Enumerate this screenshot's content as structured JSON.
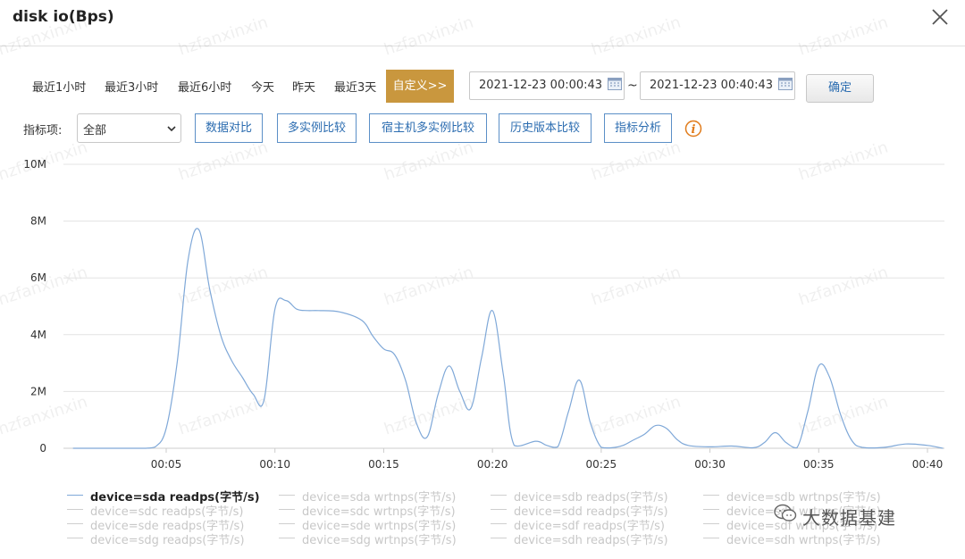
{
  "dialog": {
    "title": "disk io(Bps)",
    "watermark": "hzfanxinxin"
  },
  "time_range": {
    "options": [
      "最近1小时",
      "最近3小时",
      "最近6小时",
      "今天",
      "昨天",
      "最近3天"
    ],
    "custom_label": "自定义>>",
    "start": "2021-12-23 00:00:43",
    "separator": "~",
    "end": "2021-12-23 00:40:43",
    "confirm_label": "确定"
  },
  "metric": {
    "label": "指标项:",
    "selected": "全部",
    "buttons": [
      "数据对比",
      "多实例比较",
      "宿主机多实例比较",
      "历史版本比较",
      "指标分析"
    ]
  },
  "colors": {
    "accent": "#c9973e",
    "series_line": "#7fa8d8",
    "link": "#2b6cb0",
    "info": "#e07b1a"
  },
  "chart_data": {
    "type": "line",
    "ylim": [
      0,
      10000000
    ],
    "y_ticks": [
      "0",
      "2M",
      "4M",
      "6M",
      "8M",
      "10M"
    ],
    "x_ticks": [
      "00:05",
      "00:10",
      "00:15",
      "00:20",
      "00:25",
      "00:30",
      "00:35",
      "00:40"
    ],
    "grid": true,
    "legend_position": "bottom",
    "series": [
      {
        "name": "device=sda readps(字节/s)",
        "x": [
          "00:00:43",
          "00:02",
          "00:03",
          "00:04",
          "00:04:30",
          "00:05",
          "00:05:30",
          "00:06",
          "00:06:30",
          "00:07",
          "00:07:30",
          "00:08",
          "00:08:30",
          "00:09",
          "00:09:30",
          "00:10",
          "00:10:30",
          "00:11",
          "00:11:30",
          "00:12",
          "00:13",
          "00:14",
          "00:14:30",
          "00:15",
          "00:15:30",
          "00:16",
          "00:16:30",
          "00:17",
          "00:17:30",
          "00:18",
          "00:18:30",
          "00:19",
          "00:19:30",
          "00:20",
          "00:20:30",
          "00:21",
          "00:22",
          "00:22:30",
          "00:23",
          "00:23:30",
          "00:24",
          "00:24:30",
          "00:25",
          "00:25:30",
          "00:26",
          "00:26:30",
          "00:27",
          "00:27:30",
          "00:28",
          "00:28:30",
          "00:29",
          "00:30",
          "00:31",
          "00:32",
          "00:32:30",
          "00:33",
          "00:33:30",
          "00:34",
          "00:34:30",
          "00:35",
          "00:35:30",
          "00:36",
          "00:36:30",
          "00:37",
          "00:38",
          "00:39",
          "00:40",
          "00:40:43"
        ],
        "values": [
          0,
          0,
          0,
          0,
          50000,
          700000,
          3000000,
          6600000,
          7700000,
          5600000,
          4000000,
          3100000,
          2500000,
          1900000,
          1700000,
          4900000,
          5200000,
          4900000,
          4850000,
          4850000,
          4800000,
          4500000,
          3950000,
          3500000,
          3300000,
          2400000,
          900000,
          400000,
          1900000,
          2900000,
          2000000,
          1400000,
          3200000,
          4850000,
          2600000,
          100000,
          250000,
          100000,
          50000,
          1300000,
          2400000,
          900000,
          30000,
          20000,
          100000,
          300000,
          500000,
          800000,
          700000,
          300000,
          100000,
          50000,
          80000,
          20000,
          200000,
          550000,
          200000,
          20000,
          1300000,
          2900000,
          2500000,
          1200000,
          300000,
          30000,
          30000,
          150000,
          100000,
          0
        ]
      },
      {
        "name": "device=sda wrtnps(字节/s)"
      },
      {
        "name": "device=sdb readps(字节/s)"
      },
      {
        "name": "device=sdb wrtnps(字节/s)"
      },
      {
        "name": "device=sdc readps(字节/s)"
      },
      {
        "name": "device=sdc wrtnps(字节/s)"
      },
      {
        "name": "device=sdd readps(字节/s)"
      },
      {
        "name": "device=sdd wrtnps(字节/s)"
      },
      {
        "name": "device=sde readps(字节/s)"
      },
      {
        "name": "device=sde wrtnps(字节/s)"
      },
      {
        "name": "device=sdf readps(字节/s)"
      },
      {
        "name": "device=sdf wrtnps(字节/s)"
      },
      {
        "name": "device=sdg readps(字节/s)"
      },
      {
        "name": "device=sdg wrtnps(字节/s)"
      },
      {
        "name": "device=sdh readps(字节/s)"
      },
      {
        "name": "device=sdh wrtnps(字节/s)"
      }
    ]
  },
  "brand": {
    "text": "大数据基建",
    "logo_icon": "wechat-icon"
  }
}
